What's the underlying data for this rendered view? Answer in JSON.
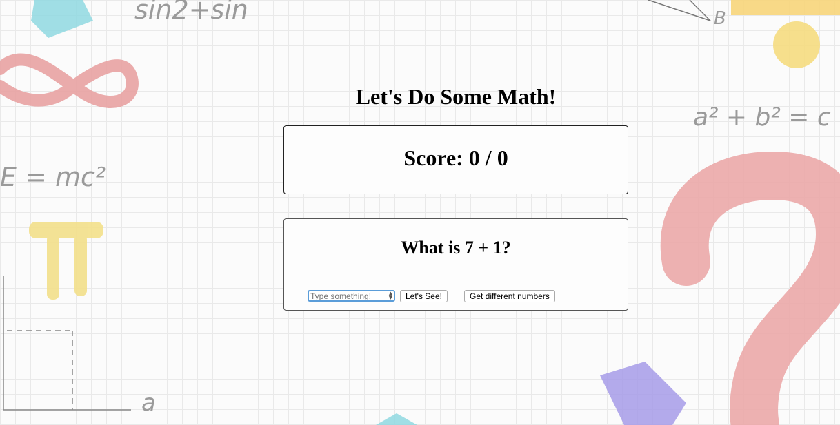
{
  "page": {
    "title": "Let's Do Some Math!"
  },
  "score": {
    "text": "Score: 0 / 0"
  },
  "question": {
    "text": "What is 7 + 1?",
    "input_placeholder": "Type something!",
    "input_value": "",
    "check_label": "Let's See!",
    "new_numbers_label": "Get different numbers"
  },
  "background": {
    "formulas": [
      "sin2+sin",
      "E = mc²",
      "a² + b² = c",
      "B",
      "a"
    ],
    "colors": {
      "grid": "#e6e6e6",
      "pink": "#e8a2a2",
      "pi_yellow": "#f3e08a",
      "purple": "#a69be8",
      "cyan": "#7fd6de",
      "orange": "#f7d57a"
    }
  }
}
